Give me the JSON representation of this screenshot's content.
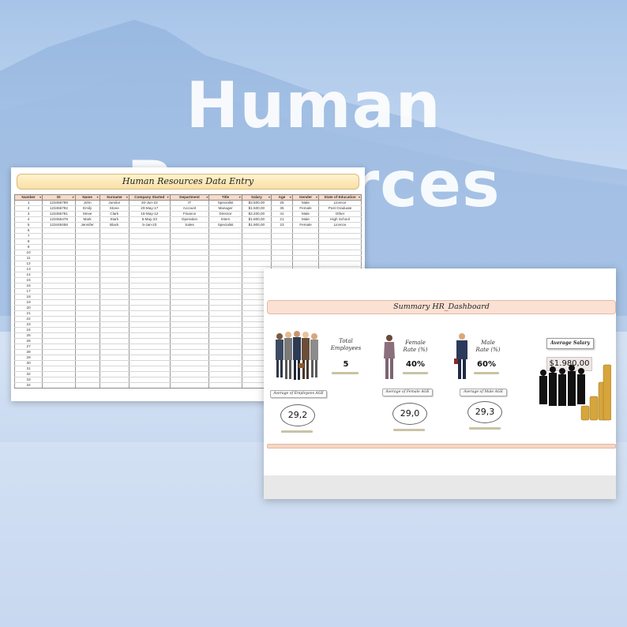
{
  "banner": {
    "title": "Human Resources"
  },
  "sheet": {
    "title": "Human Resources Data Entry",
    "columns": [
      "Number",
      "ID",
      "Name",
      "Surname",
      "Company Started",
      "Department",
      "Title",
      "Salary",
      "Age",
      "Gender",
      "State of Education"
    ],
    "rows": [
      [
        "1",
        "123456789",
        "John",
        "Jumiior",
        "20-Jun-22",
        "IT",
        "Specialist",
        "$2.500,00",
        "25",
        "Male",
        "Licence"
      ],
      [
        "2",
        "123456792",
        "Emily",
        "Stone",
        "20-May-17",
        "Account",
        "Manager",
        "$1.500,00",
        "35",
        "Female",
        "Post Graduate"
      ],
      [
        "3",
        "123455781",
        "Steve",
        "Clark",
        "15-May-12",
        "Finance",
        "Director",
        "$2.200,00",
        "41",
        "Male",
        "Other"
      ],
      [
        "4",
        "123455478",
        "Mark",
        "Stark",
        "5-May-23",
        "Operation",
        "Intern",
        "$1.800,00",
        "21",
        "Male",
        "High School"
      ],
      [
        "5",
        "123448458",
        "Jennifer",
        "Black",
        "5-Jan-23",
        "Sales",
        "Specialist",
        "$1.900,00",
        "23",
        "Female",
        "Licence"
      ],
      [
        "6"
      ],
      [
        "7"
      ],
      [
        "8"
      ],
      [
        "9"
      ],
      [
        "10"
      ],
      [
        "11"
      ],
      [
        "12"
      ],
      [
        "13"
      ],
      [
        "14"
      ],
      [
        "15"
      ],
      [
        "16"
      ],
      [
        "17"
      ],
      [
        "18"
      ],
      [
        "19"
      ],
      [
        "20"
      ],
      [
        "21"
      ],
      [
        "22"
      ],
      [
        "23"
      ],
      [
        "24"
      ],
      [
        "25"
      ],
      [
        "26"
      ],
      [
        "27"
      ],
      [
        "28"
      ],
      [
        "29"
      ],
      [
        "30"
      ],
      [
        "31"
      ],
      [
        "32"
      ],
      [
        "33"
      ],
      [
        "34"
      ]
    ]
  },
  "dashboard": {
    "title": "Summary HR_Dashboard",
    "total_employees_label": "Total\nEmployees",
    "total_employees_value": "5",
    "female_rate_label": "Female\nRate (%)",
    "female_rate_value": "40%",
    "male_rate_label": "Male\nRate (%)",
    "male_rate_value": "60%",
    "average_salary_label": "Average Salary",
    "average_salary_value": "$1.980,00",
    "avg_employees_age_label": "Average of Employees AGE",
    "avg_employees_age_value": "29,2",
    "avg_female_age_label": "Average of Female AGE",
    "avg_female_age_value": "29,0",
    "avg_male_age_label": "Average of Male AGE",
    "avg_male_age_value": "29,3"
  },
  "colors": {
    "header_fill": "#f7d9c6",
    "title_fill": "#f9dfa5",
    "dashboard_title_fill": "#fbe1d3",
    "hero_text": "#ffffff"
  }
}
